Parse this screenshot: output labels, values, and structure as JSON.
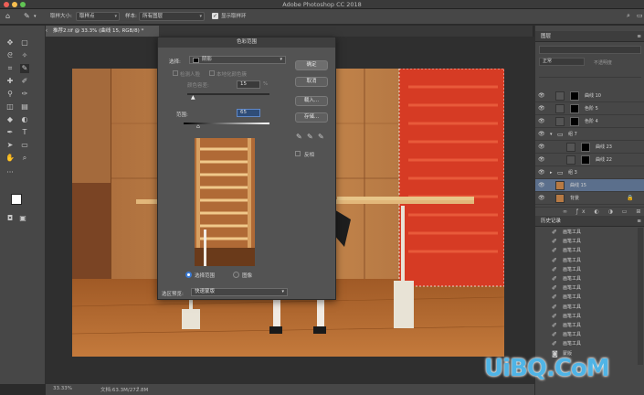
{
  "app": {
    "title": "Adobe Photoshop CC 2018"
  },
  "options_bar": {
    "sample_size_label": "取样大小:",
    "sample_size_value": "取样点",
    "sample_label": "样本:",
    "sample_value": "所有图层",
    "show_ring_label": "显示取样环"
  },
  "document": {
    "tab_label": "推荐2.tif @ 33.3% (曲线 15, RGB/8) *",
    "zoom": "33.33%",
    "doc_info": "文档:63.3M/272.8M"
  },
  "dialog": {
    "title": "色彩范围",
    "select_label": "选择:",
    "select_value": "阴影",
    "detect_faces_label": "检测人脸",
    "localized_label": "本地化颜色簇",
    "fuzziness_label": "颜色容差:",
    "fuzziness_value": "15",
    "fuzziness_unit": "%",
    "range_label": "范围:",
    "range_value": "65",
    "radio_selection": "选择范围",
    "radio_image": "图像",
    "preview_label": "选区预览:",
    "preview_value": "快速蒙版",
    "ok": "确定",
    "cancel": "取消",
    "load": "载入...",
    "save": "存储...",
    "invert_label": "反相"
  },
  "layers_panel": {
    "title": "图层",
    "kind_label": "正常",
    "opacity_label": "不透明度",
    "layers": [
      {
        "name": "曲线 10"
      },
      {
        "name": "色阶 5"
      },
      {
        "name": "色阶 4"
      },
      {
        "name": "组 7"
      },
      {
        "name": "曲线 23"
      },
      {
        "name": "曲线 22"
      },
      {
        "name": "组 3"
      },
      {
        "name": "曲线 15"
      },
      {
        "name": "背景"
      }
    ]
  },
  "history_panel": {
    "title": "历史记录",
    "items": [
      "画笔工具",
      "画笔工具",
      "画笔工具",
      "画笔工具",
      "画笔工具",
      "画笔工具",
      "画笔工具",
      "画笔工具",
      "画笔工具",
      "画笔工具",
      "画笔工具",
      "画笔工具",
      "画笔工具",
      "蒙版"
    ]
  },
  "watermark": "UiBQ.CoM"
}
